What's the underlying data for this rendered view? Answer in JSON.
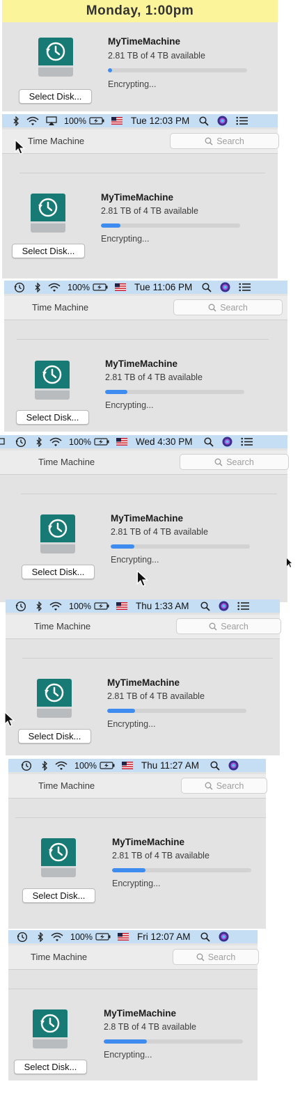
{
  "banner": {
    "label": "Monday, 1:00pm"
  },
  "app": {
    "title": "Time Machine",
    "search_placeholder": "Search",
    "select_disk_label": "Select Disk...",
    "status": "Encrypting..."
  },
  "menubar_common": {
    "battery": "100%"
  },
  "colors": {
    "menubar": "#c6def4",
    "banner": "#fcf49a",
    "progress_fill": "#3f8cf0",
    "disk_teal": "#177a75"
  },
  "snapshots": [
    {
      "clock": "",
      "disk_name": "MyTimeMachine",
      "available": "2.81 TB of 4 TB available",
      "progress": 0.03
    },
    {
      "clock": "Tue 12:03 PM",
      "disk_name": "MyTimeMachine",
      "available": "2.81 TB of 4 TB available",
      "progress": 0.14
    },
    {
      "clock": "Tue 11:06 PM",
      "disk_name": "MyTimeMachine",
      "available": "2.81 TB of 4 TB available",
      "progress": 0.16
    },
    {
      "clock": "Wed 4:30 PM",
      "disk_name": "MyTimeMachine",
      "available": "2.81 TB of 4 TB available",
      "progress": 0.17
    },
    {
      "clock": "Thu 1:33 AM",
      "disk_name": "MyTimeMachine",
      "available": "2.81 TB of 4 TB available",
      "progress": 0.2
    },
    {
      "clock": "Thu 11:27 AM",
      "disk_name": "MyTimeMachine",
      "available": "2.81 TB of 4 TB available",
      "progress": 0.24
    },
    {
      "clock": "Fri 12:07 AM",
      "disk_name": "MyTimeMachine",
      "available": "2.8 TB of 4 TB available",
      "progress": 0.31
    }
  ]
}
